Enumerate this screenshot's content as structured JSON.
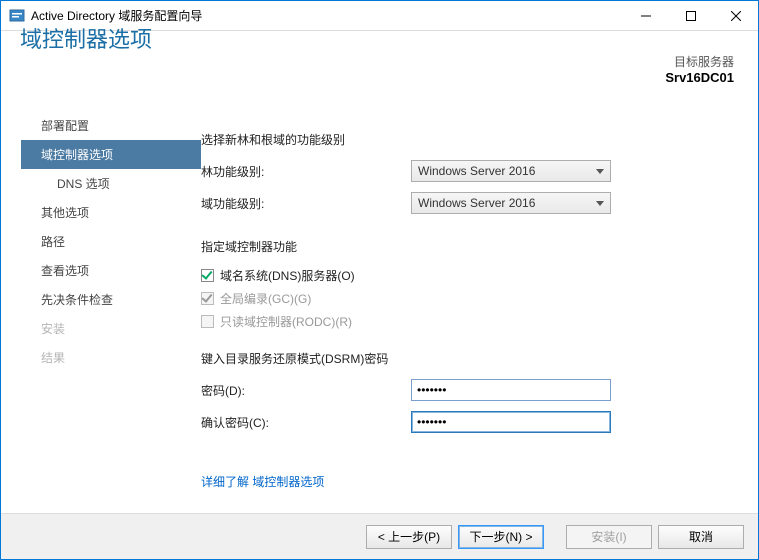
{
  "window": {
    "title": "Active Directory 域服务配置向导"
  },
  "header": {
    "pageTitle": "域控制器选项",
    "targetLabel": "目标服务器",
    "targetValue": "Srv16DC01"
  },
  "sidebar": {
    "items": [
      {
        "label": "部署配置"
      },
      {
        "label": "域控制器选项"
      },
      {
        "label": "DNS 选项"
      },
      {
        "label": "其他选项"
      },
      {
        "label": "路径"
      },
      {
        "label": "查看选项"
      },
      {
        "label": "先决条件检查"
      },
      {
        "label": "安装"
      },
      {
        "label": "结果"
      }
    ]
  },
  "content": {
    "levelsHeading": "选择新林和根域的功能级别",
    "forestLevelLabel": "林功能级别:",
    "forestLevelValue": "Windows Server 2016",
    "domainLevelLabel": "域功能级别:",
    "domainLevelValue": "Windows Server 2016",
    "capabilitiesHeading": "指定域控制器功能",
    "dnsLabel": "域名系统(DNS)服务器(O)",
    "gcLabel": "全局编录(GC)(G)",
    "rodcLabel": "只读域控制器(RODC)(R)",
    "dsrmHeading": "键入目录服务还原模式(DSRM)密码",
    "passwordLabel": "密码(D):",
    "passwordValue": "•••••••",
    "confirmLabel": "确认密码(C):",
    "confirmValue": "•••••••",
    "moreLink": "详细了解 域控制器选项"
  },
  "footer": {
    "prev": "< 上一步(P)",
    "next": "下一步(N) >",
    "install": "安装(I)",
    "cancel": "取消"
  }
}
